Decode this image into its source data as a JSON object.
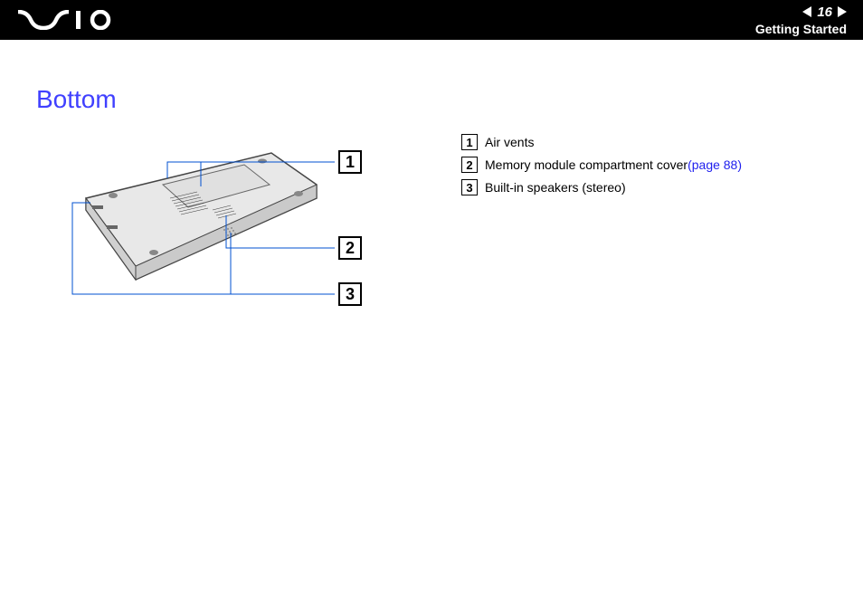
{
  "header": {
    "page_number": "16",
    "section": "Getting Started"
  },
  "page": {
    "title": "Bottom"
  },
  "callouts": {
    "c1": "1",
    "c2": "2",
    "c3": "3"
  },
  "legend": {
    "items": [
      {
        "num": "1",
        "label": "Air vents",
        "link": ""
      },
      {
        "num": "2",
        "label": "Memory module compartment cover ",
        "link": "(page 88)"
      },
      {
        "num": "3",
        "label": "Built-in speakers (stereo)",
        "link": ""
      }
    ]
  }
}
